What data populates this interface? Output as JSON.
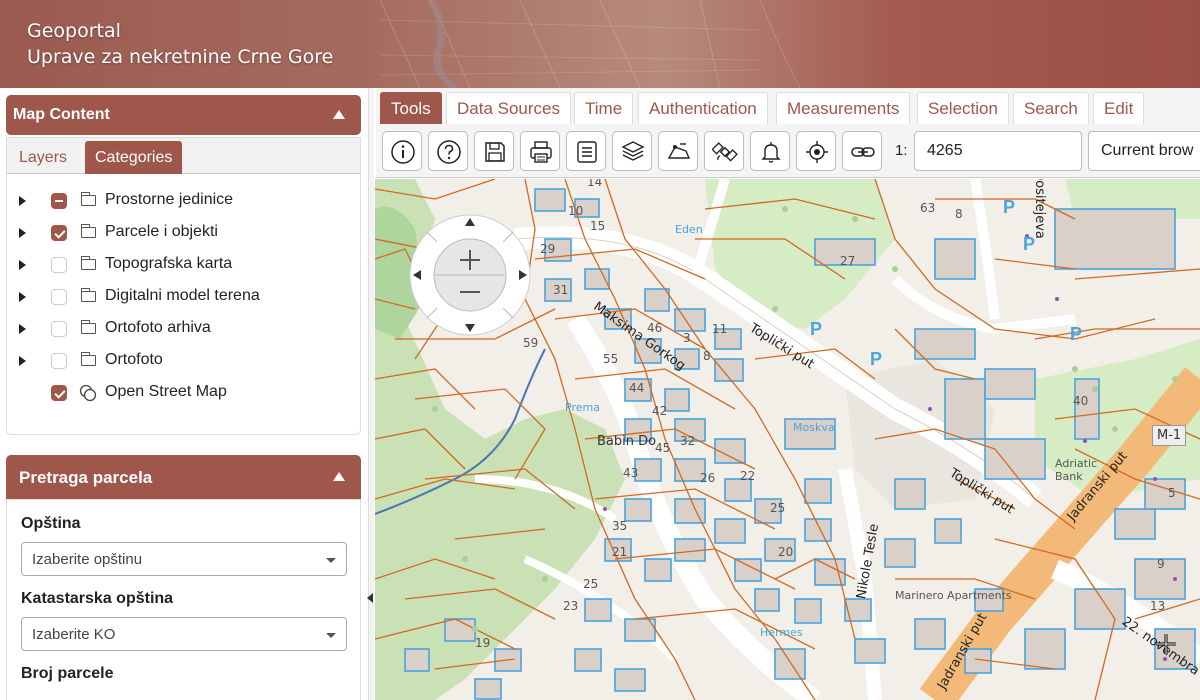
{
  "header": {
    "title_line1": "Geoportal",
    "title_line2": "Uprave za nekretnine Crne Gore"
  },
  "map_content": {
    "title": "Map Content",
    "tabs": [
      "Layers",
      "Categories"
    ],
    "active_tab": "Categories",
    "layers": [
      {
        "label": "Prostorne jedinice",
        "state": "indeterminate",
        "icon": "folder-icon",
        "expandable": true
      },
      {
        "label": "Parcele i objekti",
        "state": "checked",
        "icon": "folder-icon",
        "expandable": true
      },
      {
        "label": "Topografska karta",
        "state": "unchecked",
        "icon": "folder-icon",
        "expandable": true
      },
      {
        "label": "Digitalni model terena",
        "state": "unchecked",
        "icon": "folder-icon",
        "expandable": true
      },
      {
        "label": "Ortofoto arhiva",
        "state": "unchecked",
        "icon": "folder-icon",
        "expandable": true
      },
      {
        "label": "Ortofoto",
        "state": "unchecked",
        "icon": "folder-icon",
        "expandable": true
      },
      {
        "label": "Open Street Map",
        "state": "checked",
        "icon": "layer-bubble-icon",
        "expandable": false
      }
    ]
  },
  "parcel_search": {
    "title": "Pretraga parcela",
    "municipality_label": "Opština",
    "municipality_placeholder": "Izaberite opštinu",
    "ko_label": "Katastarska opština",
    "ko_placeholder": "Izaberite KO",
    "parcel_label": "Broj parcele"
  },
  "toolbar": {
    "tabs": [
      "Tools",
      "Data Sources",
      "Time",
      "Authentication",
      "Measurements",
      "Selection",
      "Search",
      "Edit"
    ],
    "active_tab": "Tools",
    "tools": [
      "info-icon",
      "help-icon",
      "save-icon",
      "print-icon",
      "list-icon",
      "layers-icon",
      "route-icon",
      "satellite-icon",
      "bell-icon",
      "locate-icon",
      "link-icon"
    ],
    "scale_prefix": "1:",
    "scale_value": "4265",
    "crs_value": "Current brow"
  },
  "map": {
    "road_labels": [
      "Maksima Gorkog",
      "Toplički put",
      "Toplički put",
      "Jadranski put",
      "Jadranski put",
      "Nikole Tesle",
      "22. novembra",
      "Dositejeva"
    ],
    "place_labels": [
      "Babin Do",
      "Moskva",
      "Hermes",
      "Eden",
      "Adriatic Bank",
      "Marinero Apartments",
      "Prema"
    ],
    "badge": "M-1",
    "parcel_numbers": [
      "14",
      "10",
      "15",
      "63",
      "8",
      "29",
      "27",
      "31",
      "59",
      "55",
      "46",
      "11",
      "3",
      "44",
      "42",
      "8",
      "40",
      "32",
      "45",
      "43",
      "22",
      "26",
      "25",
      "35",
      "20",
      "21",
      "23",
      "25",
      "19",
      "13",
      "5",
      "9"
    ]
  }
}
